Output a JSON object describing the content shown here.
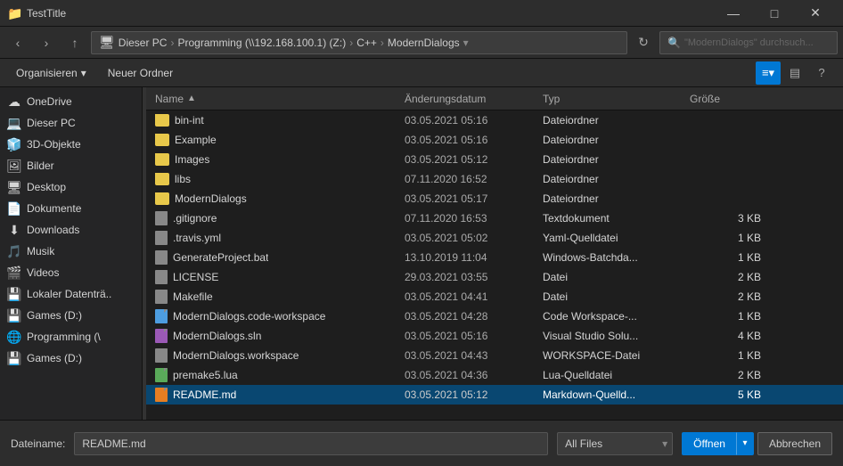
{
  "titleBar": {
    "icon": "📁",
    "title": "TestTitle",
    "minBtn": "—",
    "maxBtn": "□",
    "closeBtn": "✕"
  },
  "navBar": {
    "backBtn": "‹",
    "forwardBtn": "›",
    "upBtn": "↑",
    "breadcrumb": [
      {
        "label": "Dieser PC"
      },
      {
        "label": "Programming (\\\\192.168.100.1) (Z:)"
      },
      {
        "label": "C++"
      },
      {
        "label": "ModernDialogs"
      }
    ],
    "refreshBtn": "↻",
    "searchPlaceholder": "\"ModernDialogs\" durchsuch..."
  },
  "toolbar": {
    "organizeLabel": "Organisieren",
    "newFolderLabel": "Neuer Ordner",
    "viewGridLabel": "≡",
    "viewListLabel": "▤",
    "helpLabel": "?"
  },
  "fileListHeader": {
    "nameCol": "Name",
    "dateCol": "Änderungsdatum",
    "typeCol": "Typ",
    "sizeCol": "Größe",
    "sortArrow": "▲"
  },
  "files": [
    {
      "name": "bin-int",
      "date": "03.05.2021 05:16",
      "type": "Dateiordner",
      "size": "",
      "icon": "folder",
      "selected": false
    },
    {
      "name": "Example",
      "date": "03.05.2021 05:16",
      "type": "Dateiordner",
      "size": "",
      "icon": "folder",
      "selected": false
    },
    {
      "name": "Images",
      "date": "03.05.2021 05:12",
      "type": "Dateiordner",
      "size": "",
      "icon": "folder",
      "selected": false
    },
    {
      "name": "libs",
      "date": "07.11.2020 16:52",
      "type": "Dateiordner",
      "size": "",
      "icon": "folder",
      "selected": false
    },
    {
      "name": "ModernDialogs",
      "date": "03.05.2021 05:17",
      "type": "Dateiordner",
      "size": "",
      "icon": "folder",
      "selected": false
    },
    {
      "name": ".gitignore",
      "date": "07.11.2020 16:53",
      "type": "Textdokument",
      "size": "3 KB",
      "icon": "file",
      "selected": false
    },
    {
      "name": ".travis.yml",
      "date": "03.05.2021 05:02",
      "type": "Yaml-Quelldatei",
      "size": "1 KB",
      "icon": "file",
      "selected": false
    },
    {
      "name": "GenerateProject.bat",
      "date": "13.10.2019 11:04",
      "type": "Windows-Batchda...",
      "size": "1 KB",
      "icon": "file",
      "selected": false
    },
    {
      "name": "LICENSE",
      "date": "29.03.2021 03:55",
      "type": "Datei",
      "size": "2 KB",
      "icon": "file",
      "selected": false
    },
    {
      "name": "Makefile",
      "date": "03.05.2021 04:41",
      "type": "Datei",
      "size": "2 KB",
      "icon": "file",
      "selected": false
    },
    {
      "name": "ModernDialogs.code-workspace",
      "date": "03.05.2021 04:28",
      "type": "Code Workspace-...",
      "size": "1 KB",
      "icon": "file.blue",
      "selected": false
    },
    {
      "name": "ModernDialogs.sln",
      "date": "03.05.2021 05:16",
      "type": "Visual Studio Solu...",
      "size": "4 KB",
      "icon": "file.purple",
      "selected": false
    },
    {
      "name": "ModernDialogs.workspace",
      "date": "03.05.2021 04:43",
      "type": "WORKSPACE-Datei",
      "size": "1 KB",
      "icon": "file",
      "selected": false
    },
    {
      "name": "premake5.lua",
      "date": "03.05.2021 04:36",
      "type": "Lua-Quelldatei",
      "size": "2 KB",
      "icon": "file.green",
      "selected": false
    },
    {
      "name": "README.md",
      "date": "03.05.2021 05:12",
      "type": "Markdown-Quelld...",
      "size": "5 KB",
      "icon": "file.orange",
      "selected": true
    }
  ],
  "sidebar": {
    "items": [
      {
        "label": "OneDrive",
        "icon": "☁",
        "color": "#4d9de0",
        "active": false
      },
      {
        "label": "Dieser PC",
        "icon": "💻",
        "color": "#aaaaaa",
        "active": false
      },
      {
        "label": "3D-Objekte",
        "icon": "🧊",
        "color": "#aaaaaa",
        "active": false
      },
      {
        "label": "Bilder",
        "icon": "🖼",
        "color": "#aaaaaa",
        "active": false
      },
      {
        "label": "Desktop",
        "icon": "🖥",
        "color": "#aaaaaa",
        "active": false
      },
      {
        "label": "Dokumente",
        "icon": "📄",
        "color": "#aaaaaa",
        "active": false
      },
      {
        "label": "Downloads",
        "icon": "⬇",
        "color": "#4d9de0",
        "active": false
      },
      {
        "label": "Musik",
        "icon": "🎵",
        "color": "#aaaaaa",
        "active": false
      },
      {
        "label": "Videos",
        "icon": "🎬",
        "color": "#aaaaaa",
        "active": false
      },
      {
        "label": "Lokaler Datenträ..",
        "icon": "💾",
        "color": "#aaaaaa",
        "active": false
      },
      {
        "label": "Games (D:)",
        "icon": "💾",
        "color": "#aaaaaa",
        "active": false
      },
      {
        "label": "Programming (\\",
        "icon": "🌐",
        "color": "#aaaaaa",
        "active": false
      },
      {
        "label": "Games (D:)",
        "icon": "💾",
        "color": "#aaaaaa",
        "active": false
      }
    ]
  },
  "bottomBar": {
    "filenameLabel": "Dateiname:",
    "filenameValue": "README.md",
    "filetypeValue": "All Files",
    "openBtn": "Öffnen",
    "openArrow": "▾",
    "cancelBtn": "Abbrechen"
  }
}
